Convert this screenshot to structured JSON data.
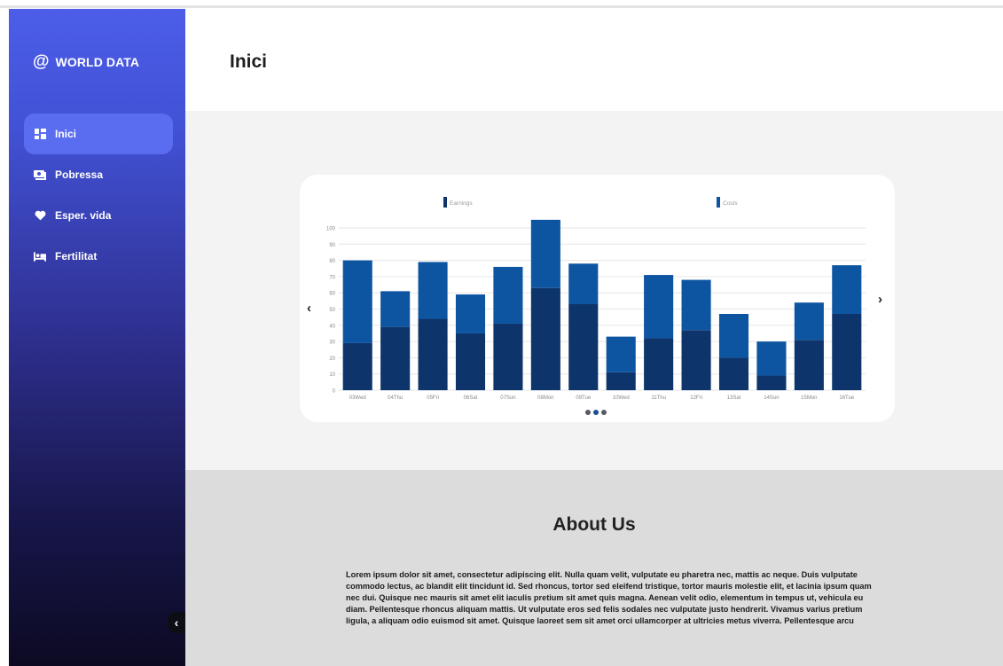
{
  "brand": {
    "at_symbol": "@",
    "name": "WORLD DATA"
  },
  "sidebar": {
    "items": [
      {
        "label": "Inici",
        "icon": "dashboard-icon",
        "active": true
      },
      {
        "label": "Pobressa",
        "icon": "money-icon",
        "active": false
      },
      {
        "label": "Esper. vida",
        "icon": "heart-icon",
        "active": false
      },
      {
        "label": "Fertilitat",
        "icon": "bed-icon",
        "active": false
      }
    ],
    "collapse_icon": "chevron-left-icon"
  },
  "header": {
    "title": "Inici"
  },
  "carousel": {
    "prev_label": "‹",
    "next_label": "›",
    "page_count": 3,
    "active_page": 2
  },
  "chart_data": {
    "type": "bar",
    "stacked": true,
    "categories": [
      "03Wed",
      "04Thu",
      "05Fri",
      "06Sat",
      "07Sun",
      "08Mon",
      "09Tue",
      "10Wed",
      "11Thu",
      "12Fri",
      "13Sat",
      "14Sun",
      "15Mon",
      "16Tue"
    ],
    "tick_labels": [
      "03Wed",
      "04Thu",
      "05Fri",
      "06Sat",
      "07Sun",
      "08Mon",
      "09Tue",
      "10Wed",
      "11Thu",
      "12Fri",
      "13Sat",
      "14Sun",
      "15Mon",
      "16Tue"
    ],
    "series": [
      {
        "name": "Earnings",
        "color": "#0d346b",
        "values": [
          29,
          39,
          44,
          35,
          41,
          63,
          53,
          11,
          32,
          37,
          20,
          9,
          31,
          47
        ]
      },
      {
        "name": "Costs",
        "color": "#0d55a1",
        "values": [
          51,
          22,
          35,
          24,
          35,
          42,
          25,
          22,
          39,
          31,
          27,
          21,
          23,
          30
        ]
      }
    ],
    "ylim": [
      0,
      100
    ],
    "yticks": [
      0,
      10,
      20,
      30,
      40,
      50,
      60,
      70,
      80,
      90,
      100
    ],
    "grid": true,
    "legend_position": "top"
  },
  "about": {
    "title": "About Us",
    "text": "Lorem ipsum dolor sit amet, consectetur adipiscing elit. Nulla quam velit, vulputate eu pharetra nec, mattis ac neque. Duis vulputate commodo lectus, ac blandit elit tincidunt id. Sed rhoncus, tortor sed eleifend tristique, tortor mauris molestie elit, et lacinia ipsum quam nec dui. Quisque nec mauris sit amet elit iaculis pretium sit amet quis magna. Aenean velit odio, elementum in tempus ut, vehicula eu diam. Pellentesque rhoncus aliquam mattis. Ut vulputate eros sed felis sodales nec vulputate justo hendrerit. Vivamus varius pretium ligula, a aliquam odio euismod sit amet. Quisque laoreet sem sit amet orci ullamcorper at ultricies metus viverra. Pellentesque arcu"
  }
}
